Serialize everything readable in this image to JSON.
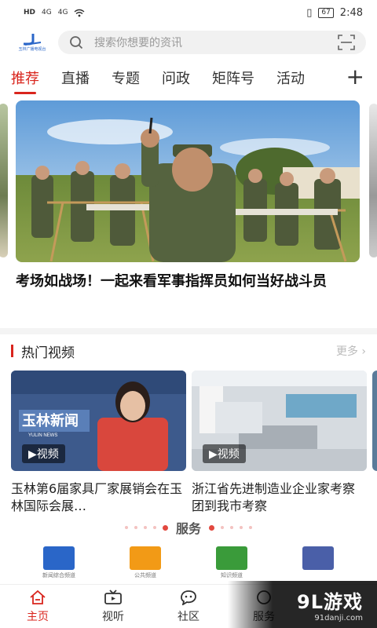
{
  "status_bar": {
    "left_signal_1": "HD",
    "left_signal_2": "HD",
    "net_1": "4G",
    "net_2": "4G",
    "battery": "67",
    "time": "2:48"
  },
  "search": {
    "placeholder": "搜索你想要的资讯"
  },
  "logo": {
    "text": "玉林广播电视台"
  },
  "tabs": [
    {
      "label": "推荐",
      "active": true
    },
    {
      "label": "直播"
    },
    {
      "label": "专题"
    },
    {
      "label": "问政"
    },
    {
      "label": "矩阵号"
    },
    {
      "label": "活动"
    }
  ],
  "hero": {
    "headline": "考场如战场！一起来看军事指挥员如何当好战斗员"
  },
  "hot_video": {
    "title": "热门视频",
    "more": "更多",
    "items": [
      {
        "title": "玉林第6届家具厂家展销会在玉林国际会展…",
        "badge": "视频",
        "thumb_caption": "YULIN NEWS",
        "thumb_brand": "玉林新闻"
      },
      {
        "title": "浙江省先进制造业企业家考察团到我市考察",
        "badge": "视频"
      }
    ]
  },
  "services": {
    "title": "服务",
    "items": [
      {
        "label": "新闻综合频道",
        "color": "#2a66c8"
      },
      {
        "label": "公共频道",
        "color": "#f29a16"
      },
      {
        "label": "知识频道",
        "color": "#3a9b3a"
      },
      {
        "label": "",
        "color": "#4a5fa8"
      }
    ]
  },
  "bottom_nav": [
    {
      "label": "主页",
      "icon": "home-icon",
      "active": true
    },
    {
      "label": "视听",
      "icon": "tv-icon"
    },
    {
      "label": "社区",
      "icon": "community-icon"
    },
    {
      "label": "服务",
      "icon": "service-icon"
    }
  ],
  "watermark": {
    "main": "9L游戏",
    "sub": "91danji.com"
  },
  "colors": {
    "accent": "#d9251d",
    "search_bg": "#f1f1f1"
  }
}
